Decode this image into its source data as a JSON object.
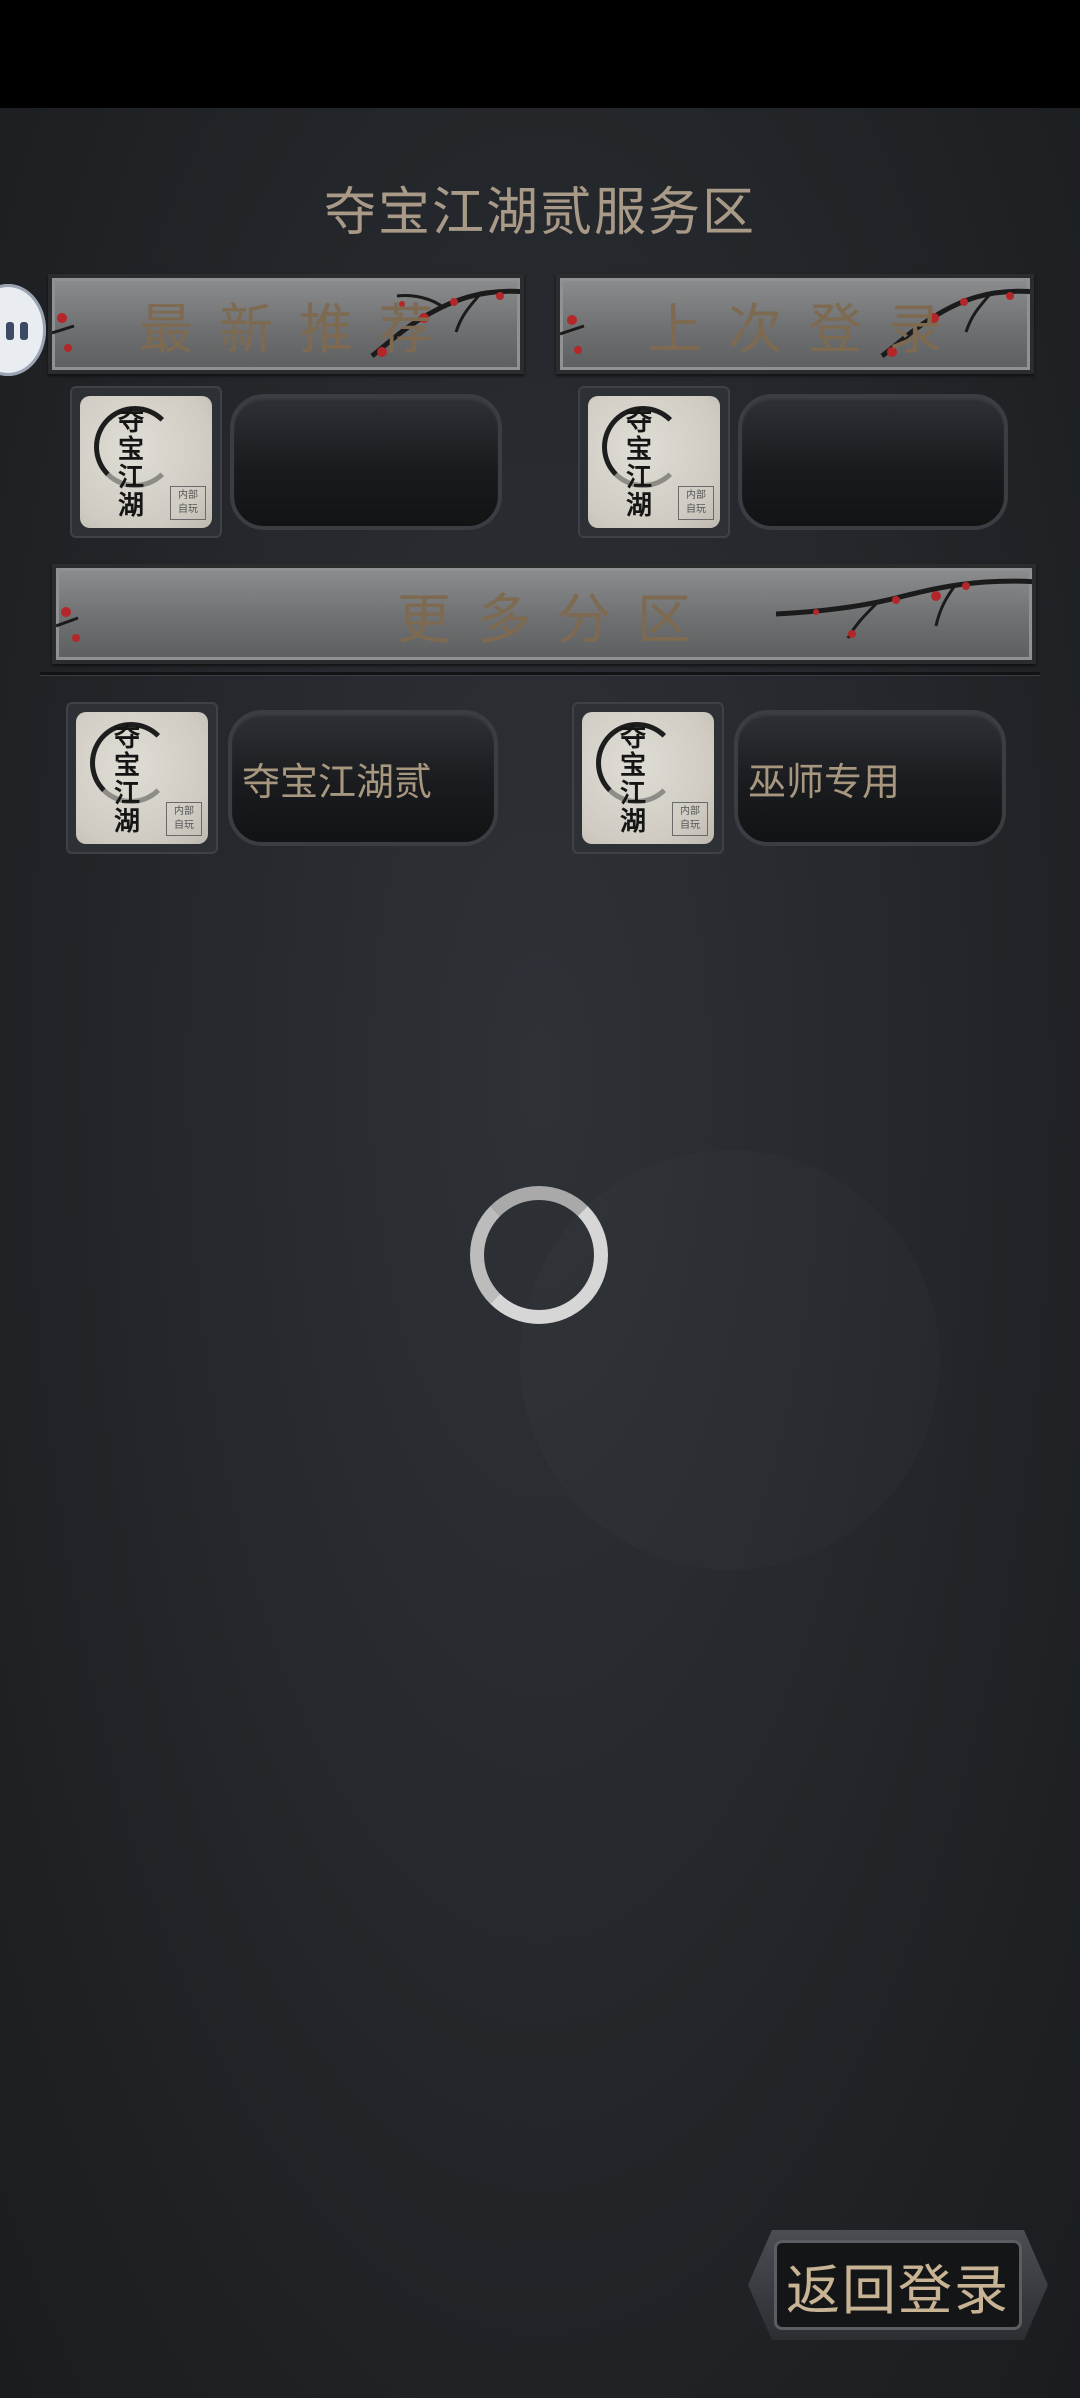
{
  "page": {
    "title": "夺宝江湖贰服务区"
  },
  "sections": {
    "latest": {
      "label": "最新推荐"
    },
    "last_login": {
      "label": "上次登录"
    },
    "more": {
      "label": "更多分区"
    }
  },
  "server_icon": {
    "calligraphy": [
      "夺",
      "宝",
      "江",
      "湖"
    ],
    "seal_lines": [
      "内部",
      "自玩"
    ]
  },
  "servers": {
    "latest": {
      "name": ""
    },
    "last_login": {
      "name": ""
    },
    "more": [
      {
        "name": "夺宝江湖贰"
      },
      {
        "name": "巫师专用"
      }
    ]
  },
  "loading": {
    "icon": "loading-spinner-icon"
  },
  "floating_ball": {
    "icon": "assistant-ball-icon"
  },
  "actions": {
    "back_label": "返回登录"
  },
  "colors": {
    "title": "#a89a86",
    "banner_text": "#7d6a50",
    "server_text": "#a8977f",
    "back_text": "#c8b494",
    "plum_blossom": "#b3262a"
  }
}
